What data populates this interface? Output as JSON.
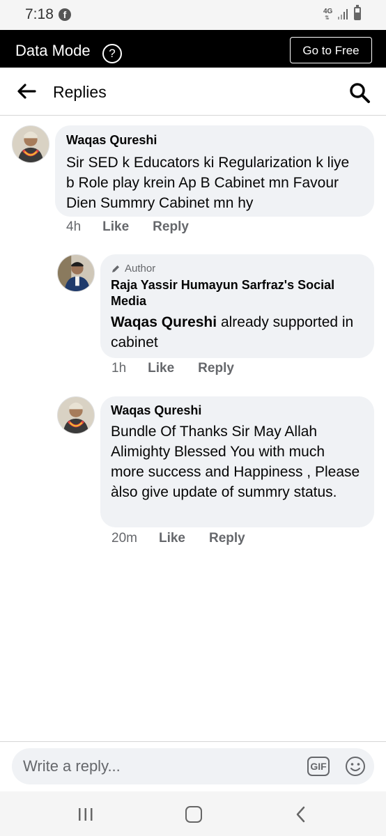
{
  "status_bar": {
    "time": "7:18",
    "app_icon": "facebook-icon",
    "network": "4G",
    "icons": [
      "facebook-icon",
      "signal-icon",
      "battery-icon"
    ]
  },
  "data_mode_bar": {
    "label": "Data Mode",
    "help_icon": "?",
    "go_free_label": "Go to Free"
  },
  "header": {
    "title": "Replies",
    "icons": [
      "back-arrow-icon",
      "search-icon"
    ]
  },
  "comments": [
    {
      "author": "Waqas Qureshi",
      "text": "Sir SED k Educators ki Regularization k liye b Role play krein Ap B Cabinet mn Favour Dien Summry Cabinet mn hy",
      "time": "4h",
      "like_label": "Like",
      "reply_label": "Reply"
    },
    {
      "badge": "Author",
      "author": "Raja Yassir Humayun Sarfraz's Social Media",
      "mention": "Waqas Qureshi",
      "text": " already supported in cabinet",
      "time": "1h",
      "like_label": "Like",
      "reply_label": "Reply"
    },
    {
      "author": "Waqas Qureshi",
      "text": "Bundle Of Thanks Sir May Allah Alimighty Blessed You with much more success and Happiness , Please àlso give update of summry status.",
      "time": "20m",
      "like_label": "Like",
      "reply_label": "Reply"
    }
  ],
  "composer": {
    "placeholder": "Write a reply...",
    "gif_label": "GIF",
    "icons": [
      "gif-icon",
      "emoji-icon"
    ]
  },
  "nav_bar": {
    "icons": [
      "recent-apps-icon",
      "home-icon",
      "back-icon"
    ]
  },
  "colors": {
    "bubble": "#f0f2f5",
    "meta_text": "#65676b",
    "data_bar": "#000000"
  }
}
